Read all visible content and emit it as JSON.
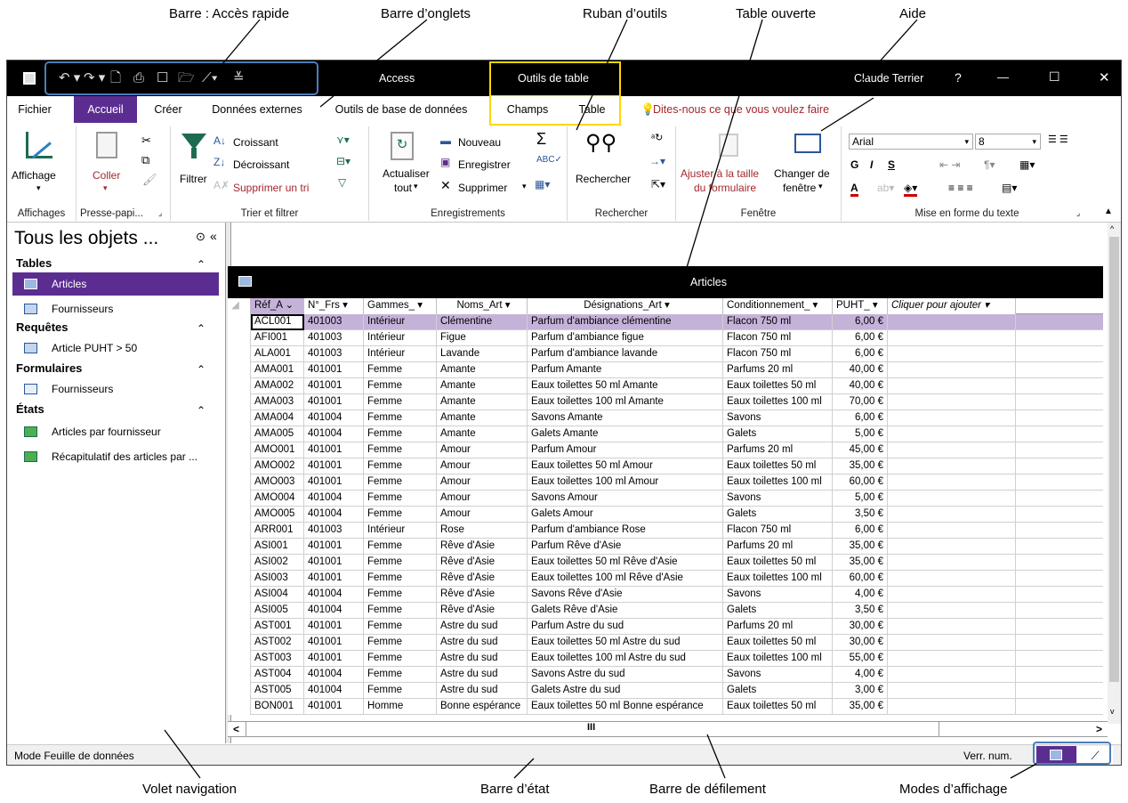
{
  "callouts": {
    "qat": "Barre : Accès rapide",
    "tabs": "Barre d’onglets",
    "ribbon": "Ruban d’outils",
    "table": "Table ouverte",
    "help": "Aide",
    "nav": "Volet navigation",
    "status": "Barre d’état",
    "scroll": "Barre de défilement",
    "views": "Modes d’affichage"
  },
  "titlebar": {
    "app": "Access",
    "tools": "Outils de table",
    "user": "Claude Terrier",
    "help": "?",
    "min": "—",
    "max": "☐",
    "close": "✕"
  },
  "tabs": [
    "Fichier",
    "Accueil",
    "Créer",
    "Données externes",
    "Outils de base de données",
    "Champs",
    "Table"
  ],
  "tellme": "Dites-nous ce que vous voulez faire",
  "ribbon": {
    "affichage": "Affichage",
    "affichages": "Affichages",
    "coller": "Coller",
    "pressepapier": "Presse-papi...",
    "filtrer": "Filtrer",
    "croissant": "Croissant",
    "decroissant": "Décroissant",
    "supprimer_tri": "Supprimer un tri",
    "trier_filtrer": "Trier et filtrer",
    "actualiser": "Actualiser",
    "tout": "tout",
    "nouveau": "Nouveau",
    "enregistrer": "Enregistrer",
    "supprimer": "Supprimer",
    "enregistrements": "Enregistrements",
    "rechercher_btn": "Rechercher",
    "rechercher": "Rechercher",
    "ajuster1": "Ajuster à la taille",
    "ajuster2": "du formulaire",
    "changer1": "Changer de",
    "changer2": "fenêtre",
    "fenetre": "Fenêtre",
    "font": "Arial",
    "size": "8",
    "mise_en_forme": "Mise en forme du texte"
  },
  "nav": {
    "title": "Tous les objets ...",
    "sections": [
      {
        "name": "Tables",
        "items": [
          "Articles",
          "Fournisseurs"
        ]
      },
      {
        "name": "Requêtes",
        "items": [
          "Article PUHT > 50"
        ]
      },
      {
        "name": "Formulaires",
        "items": [
          "Fournisseurs"
        ]
      },
      {
        "name": "États",
        "items": [
          "Articles par fournisseur",
          "Récapitulatif des articles par ..."
        ]
      }
    ]
  },
  "table": {
    "title": "Articles",
    "headers": [
      "Réf_A",
      "N°_Frs",
      "Gammes_",
      "Noms_Art",
      "Désignations_Art",
      "Conditionnement_",
      "PUHT_",
      "Cliquer pour ajouter"
    ],
    "rows": [
      [
        "ACL001",
        "401003",
        "Intérieur",
        "Clémentine",
        "Parfum d'ambiance clémentine",
        "Flacon 750 ml",
        "6,00 €"
      ],
      [
        "AFI001",
        "401003",
        "Intérieur",
        "Figue",
        "Parfum d'ambiance figue",
        "Flacon 750 ml",
        "6,00 €"
      ],
      [
        "ALA001",
        "401003",
        "Intérieur",
        "Lavande",
        "Parfum d'ambiance lavande",
        "Flacon 750 ml",
        "6,00 €"
      ],
      [
        "AMA001",
        "401001",
        "Femme",
        "Amante",
        "Parfum Amante",
        "Parfums 20 ml",
        "40,00 €"
      ],
      [
        "AMA002",
        "401001",
        "Femme",
        "Amante",
        "Eaux toilettes 50 ml Amante",
        "Eaux toilettes 50 ml",
        "40,00 €"
      ],
      [
        "AMA003",
        "401001",
        "Femme",
        "Amante",
        "Eaux toilettes 100 ml Amante",
        "Eaux toilettes 100 ml",
        "70,00 €"
      ],
      [
        "AMA004",
        "401004",
        "Femme",
        "Amante",
        "Savons Amante",
        "Savons",
        "6,00 €"
      ],
      [
        "AMA005",
        "401004",
        "Femme",
        "Amante",
        "Galets Amante",
        "Galets",
        "5,00 €"
      ],
      [
        "AMO001",
        "401001",
        "Femme",
        "Amour",
        "Parfum Amour",
        "Parfums 20 ml",
        "45,00 €"
      ],
      [
        "AMO002",
        "401001",
        "Femme",
        "Amour",
        "Eaux toilettes 50 ml Amour",
        "Eaux toilettes 50 ml",
        "35,00 €"
      ],
      [
        "AMO003",
        "401001",
        "Femme",
        "Amour",
        "Eaux toilettes 100 ml Amour",
        "Eaux toilettes 100 ml",
        "60,00 €"
      ],
      [
        "AMO004",
        "401004",
        "Femme",
        "Amour",
        "Savons Amour",
        "Savons",
        "5,00 €"
      ],
      [
        "AMO005",
        "401004",
        "Femme",
        "Amour",
        "Galets Amour",
        "Galets",
        "3,50 €"
      ],
      [
        "ARR001",
        "401003",
        "Intérieur",
        "Rose",
        "Parfum d'ambiance Rose",
        "Flacon 750 ml",
        "6,00 €"
      ],
      [
        "ASI001",
        "401001",
        "Femme",
        "Rêve d'Asie",
        "Parfum Rêve d'Asie",
        "Parfums 20 ml",
        "35,00 €"
      ],
      [
        "ASI002",
        "401001",
        "Femme",
        "Rêve d'Asie",
        "Eaux toilettes 50 ml Rêve d'Asie",
        "Eaux toilettes 50 ml",
        "35,00 €"
      ],
      [
        "ASI003",
        "401001",
        "Femme",
        "Rêve d'Asie",
        "Eaux toilettes 100 ml Rêve d'Asie",
        "Eaux toilettes 100 ml",
        "60,00 €"
      ],
      [
        "ASI004",
        "401004",
        "Femme",
        "Rêve d'Asie",
        "Savons Rêve d'Asie",
        "Savons",
        "4,00 €"
      ],
      [
        "ASI005",
        "401004",
        "Femme",
        "Rêve d'Asie",
        "Galets Rêve d'Asie",
        "Galets",
        "3,50 €"
      ],
      [
        "AST001",
        "401001",
        "Femme",
        "Astre du sud",
        "Parfum Astre du sud",
        "Parfums 20 ml",
        "30,00 €"
      ],
      [
        "AST002",
        "401001",
        "Femme",
        "Astre du sud",
        "Eaux toilettes 50 ml Astre du sud",
        "Eaux toilettes 50 ml",
        "30,00 €"
      ],
      [
        "AST003",
        "401001",
        "Femme",
        "Astre du sud",
        "Eaux toilettes 100 ml Astre du sud",
        "Eaux toilettes 100 ml",
        "55,00 €"
      ],
      [
        "AST004",
        "401004",
        "Femme",
        "Astre du sud",
        "Savons Astre du sud",
        "Savons",
        "4,00 €"
      ],
      [
        "AST005",
        "401004",
        "Femme",
        "Astre du sud",
        "Galets Astre du sud",
        "Galets",
        "3,00 €"
      ],
      [
        "BON001",
        "401001",
        "Homme",
        "Bonne espérance",
        "Eaux toilettes 50 ml Bonne espérance",
        "Eaux toilettes 50 ml",
        "35,00 €"
      ]
    ]
  },
  "status": {
    "mode": "Mode Feuille de données",
    "numlock": "Verr. num."
  },
  "colors": {
    "accent": "#5c2d91",
    "titlebar": "#000000",
    "highlight_yellow": "#ffd700",
    "highlight_blue": "#4a7ebb",
    "selected_row": "#c4b2d9",
    "tellme": "#a4262c"
  }
}
